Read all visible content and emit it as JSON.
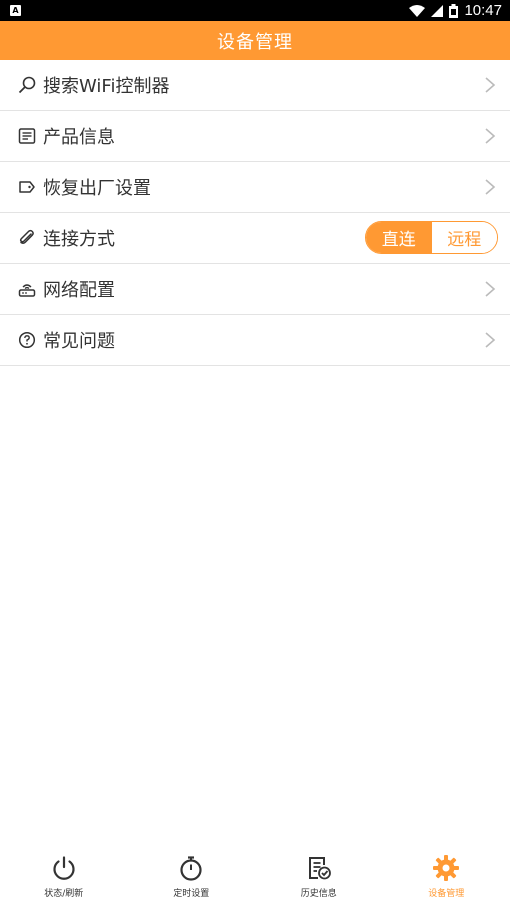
{
  "statusbar": {
    "time": "10:47",
    "left_badge": "A"
  },
  "header": {
    "title": "设备管理"
  },
  "menu": {
    "items": [
      {
        "label": "搜索WiFi控制器",
        "icon": "search-icon"
      },
      {
        "label": "产品信息",
        "icon": "document-icon"
      },
      {
        "label": "恢复出厂设置",
        "icon": "tag-icon"
      },
      {
        "label": "连接方式",
        "icon": "paperclip-icon"
      },
      {
        "label": "网络配置",
        "icon": "router-icon"
      },
      {
        "label": "常见问题",
        "icon": "question-icon"
      }
    ],
    "connection_toggle": {
      "options": [
        "直连",
        "远程"
      ],
      "selected": "直连"
    }
  },
  "tabbar": {
    "tabs": [
      {
        "label": "状态/刷新",
        "icon": "power-icon",
        "active": false
      },
      {
        "label": "定时设置",
        "icon": "stopwatch-icon",
        "active": false
      },
      {
        "label": "历史信息",
        "icon": "history-document-icon",
        "active": false
      },
      {
        "label": "设备管理",
        "icon": "gear-icon",
        "active": true
      }
    ]
  },
  "colors": {
    "accent": "#FF9933",
    "divider": "#E3E3E3",
    "text": "#333333"
  }
}
